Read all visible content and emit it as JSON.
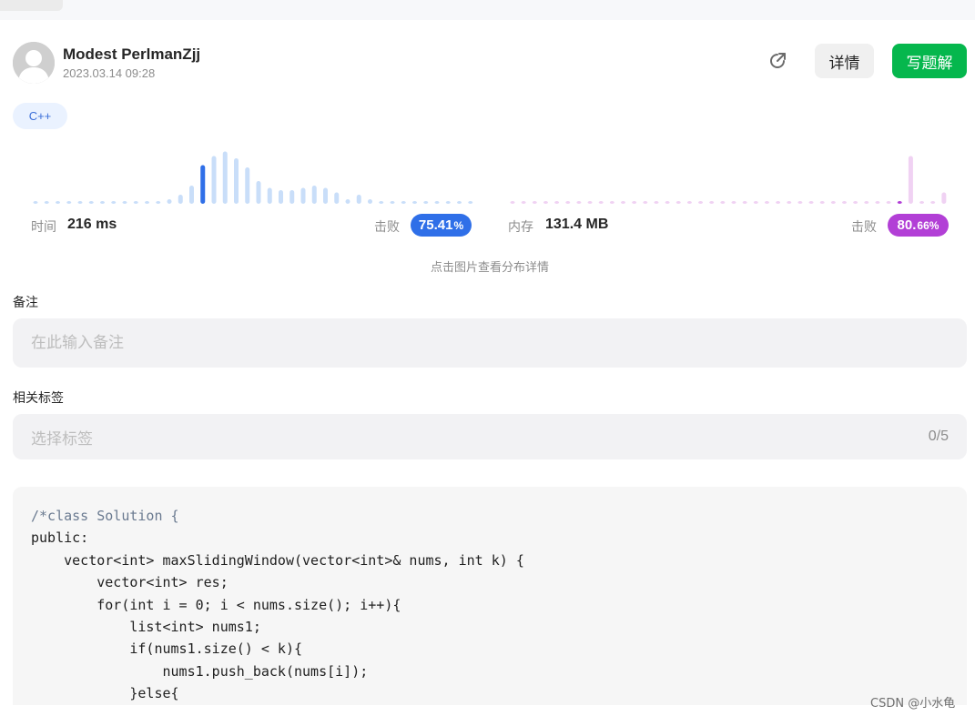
{
  "author": {
    "name": "Modest PerlmanZjj",
    "timestamp": "2023.03.14 09:28"
  },
  "actions": {
    "detail_label": "详情",
    "write_label": "写题解"
  },
  "language_tag": "C++",
  "stats": {
    "runtime": {
      "label": "时间",
      "value": "216 ms",
      "beat_label": "击败",
      "beat_main": "75.41",
      "beat_suffix": "%",
      "beat_percent": 75.41
    },
    "memory": {
      "label": "内存",
      "value": "131.4 MB",
      "beat_label": "击败",
      "beat_main": "80.",
      "beat_suffix": "66%",
      "beat_percent": 80.66
    }
  },
  "chart_hint": "点击图片查看分布详情",
  "chart_data": [
    {
      "type": "bar",
      "values": [
        1,
        1,
        1,
        1,
        1,
        1,
        1,
        1,
        1,
        1,
        1,
        1,
        2,
        4,
        8,
        17,
        21,
        23,
        20,
        16,
        10,
        7,
        6,
        6,
        7,
        8,
        7,
        5,
        2,
        4,
        2,
        1,
        1,
        1,
        1,
        1,
        1,
        1,
        1,
        1
      ],
      "highlight_index": 15,
      "colors": {
        "base": "#c9def9",
        "highlight": "#2f6fe8"
      }
    },
    {
      "type": "bar",
      "values": [
        1,
        1,
        1,
        1,
        1,
        1,
        1,
        1,
        1,
        1,
        1,
        1,
        1,
        1,
        1,
        1,
        1,
        1,
        1,
        1,
        1,
        1,
        1,
        1,
        1,
        1,
        1,
        1,
        1,
        1,
        1,
        1,
        1,
        1,
        1,
        1,
        21,
        1,
        1,
        5
      ],
      "highlight_index": 35,
      "colors": {
        "base": "#f0d2f3",
        "highlight": "#b23fd6"
      }
    }
  ],
  "notes": {
    "label": "备注",
    "placeholder": "在此输入备注"
  },
  "tags": {
    "label": "相关标签",
    "placeholder": "选择标签",
    "count": "0/5"
  },
  "code": [
    "/*class Solution {",
    "public:",
    "    vector<int> maxSlidingWindow(vector<int>& nums, int k) {",
    "        vector<int> res;",
    "        for(int i = 0; i < nums.size(); i++){",
    "            list<int> nums1;",
    "            if(nums1.size() < k){",
    "                nums1.push_back(nums[i]);",
    "            }else{"
  ],
  "watermark": "CSDN @小水龟",
  "colors": {
    "accent_green": "#05b74d",
    "runtime_blue": "#2f6fe8",
    "memory_purple": "#b23fd6"
  }
}
